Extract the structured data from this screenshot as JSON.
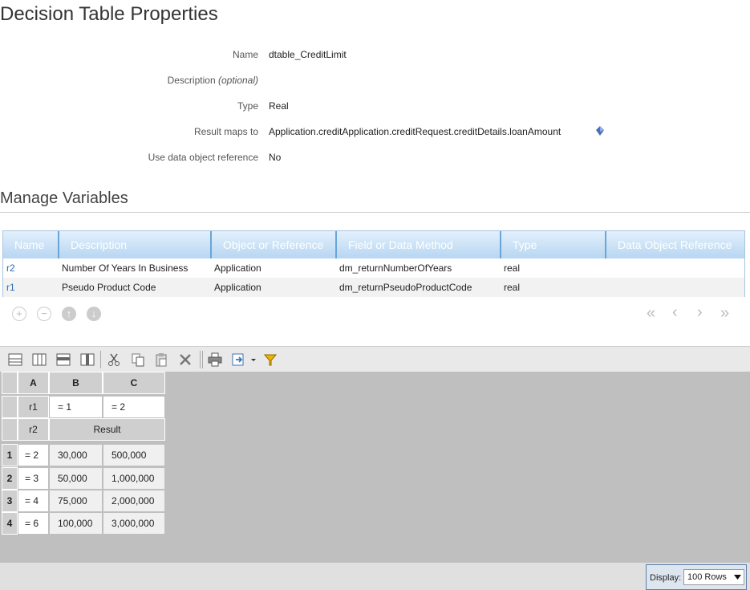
{
  "page_title": "Decision Table Properties",
  "properties": {
    "name_label": "Name",
    "name_value": "dtable_CreditLimit",
    "description_label": "Description",
    "description_optional": "(optional)",
    "type_label": "Type",
    "type_value": "Real",
    "result_maps_label": "Result maps to",
    "result_maps_value": "Application.creditApplication.creditRequest.creditDetails.loanAmount",
    "use_ref_label": "Use data object reference",
    "use_ref_value": "No"
  },
  "variables": {
    "title": "Manage Variables",
    "columns": [
      "Name",
      "Description",
      "Object or Reference",
      "Field or Data Method",
      "Type",
      "Data Object Reference"
    ],
    "rows": [
      {
        "name": "r2",
        "description": "Number Of Years In Business",
        "object": "Application",
        "field": "dm_returnNumberOfYears",
        "type": "real",
        "ref": ""
      },
      {
        "name": "r1",
        "description": "Pseudo Product Code",
        "object": "Application",
        "field": "dm_returnPseudoProductCode",
        "type": "real",
        "ref": ""
      }
    ],
    "actions": [
      "add-icon",
      "remove-icon",
      "move-up-icon",
      "move-down-icon"
    ],
    "pager": [
      "first-page-icon",
      "prev-page-icon",
      "next-page-icon",
      "last-page-icon"
    ]
  },
  "decision_table": {
    "col_headers": [
      "A",
      "B",
      "C"
    ],
    "r1_label": "r1",
    "r1_values": [
      "= 1",
      "= 2"
    ],
    "r2_label": "r2",
    "result_label": "Result",
    "rows": [
      {
        "num": "1",
        "cond": "= 2",
        "b": "30,000",
        "c": "500,000"
      },
      {
        "num": "2",
        "cond": "= 3",
        "b": "50,000",
        "c": "1,000,000"
      },
      {
        "num": "3",
        "cond": "= 4",
        "b": "75,000",
        "c": "2,000,000"
      },
      {
        "num": "4",
        "cond": "= 6",
        "b": "100,000",
        "c": "3,000,000"
      }
    ]
  },
  "display": {
    "label": "Display:",
    "value": "100 Rows"
  },
  "colors": {
    "link": "#2a6db5",
    "header_gradient_top": "#e3f0fb",
    "header_gradient_bottom": "#b7d6f2",
    "grid_background": "#bfbfbf"
  }
}
